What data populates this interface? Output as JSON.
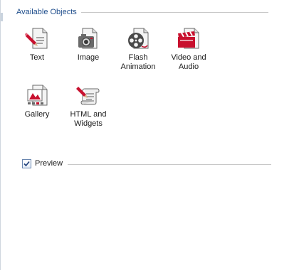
{
  "panel": {
    "group_title": "Available Objects"
  },
  "objects": [
    {
      "label": "Text",
      "icon": "text-document-icon"
    },
    {
      "label": "Image",
      "icon": "camera-icon"
    },
    {
      "label": "Flash\nAnimation",
      "icon": "film-reel-icon"
    },
    {
      "label": "Video and\nAudio",
      "icon": "clapperboard-icon"
    },
    {
      "label": "Gallery",
      "icon": "gallery-icon"
    },
    {
      "label": "HTML and\nWidgets",
      "icon": "scroll-pen-icon"
    }
  ],
  "preview": {
    "label": "Preview",
    "checked": true
  },
  "colors": {
    "accent": "#1f4e8c",
    "icon_red": "#c8102e",
    "icon_gray": "#5a5a5a"
  }
}
